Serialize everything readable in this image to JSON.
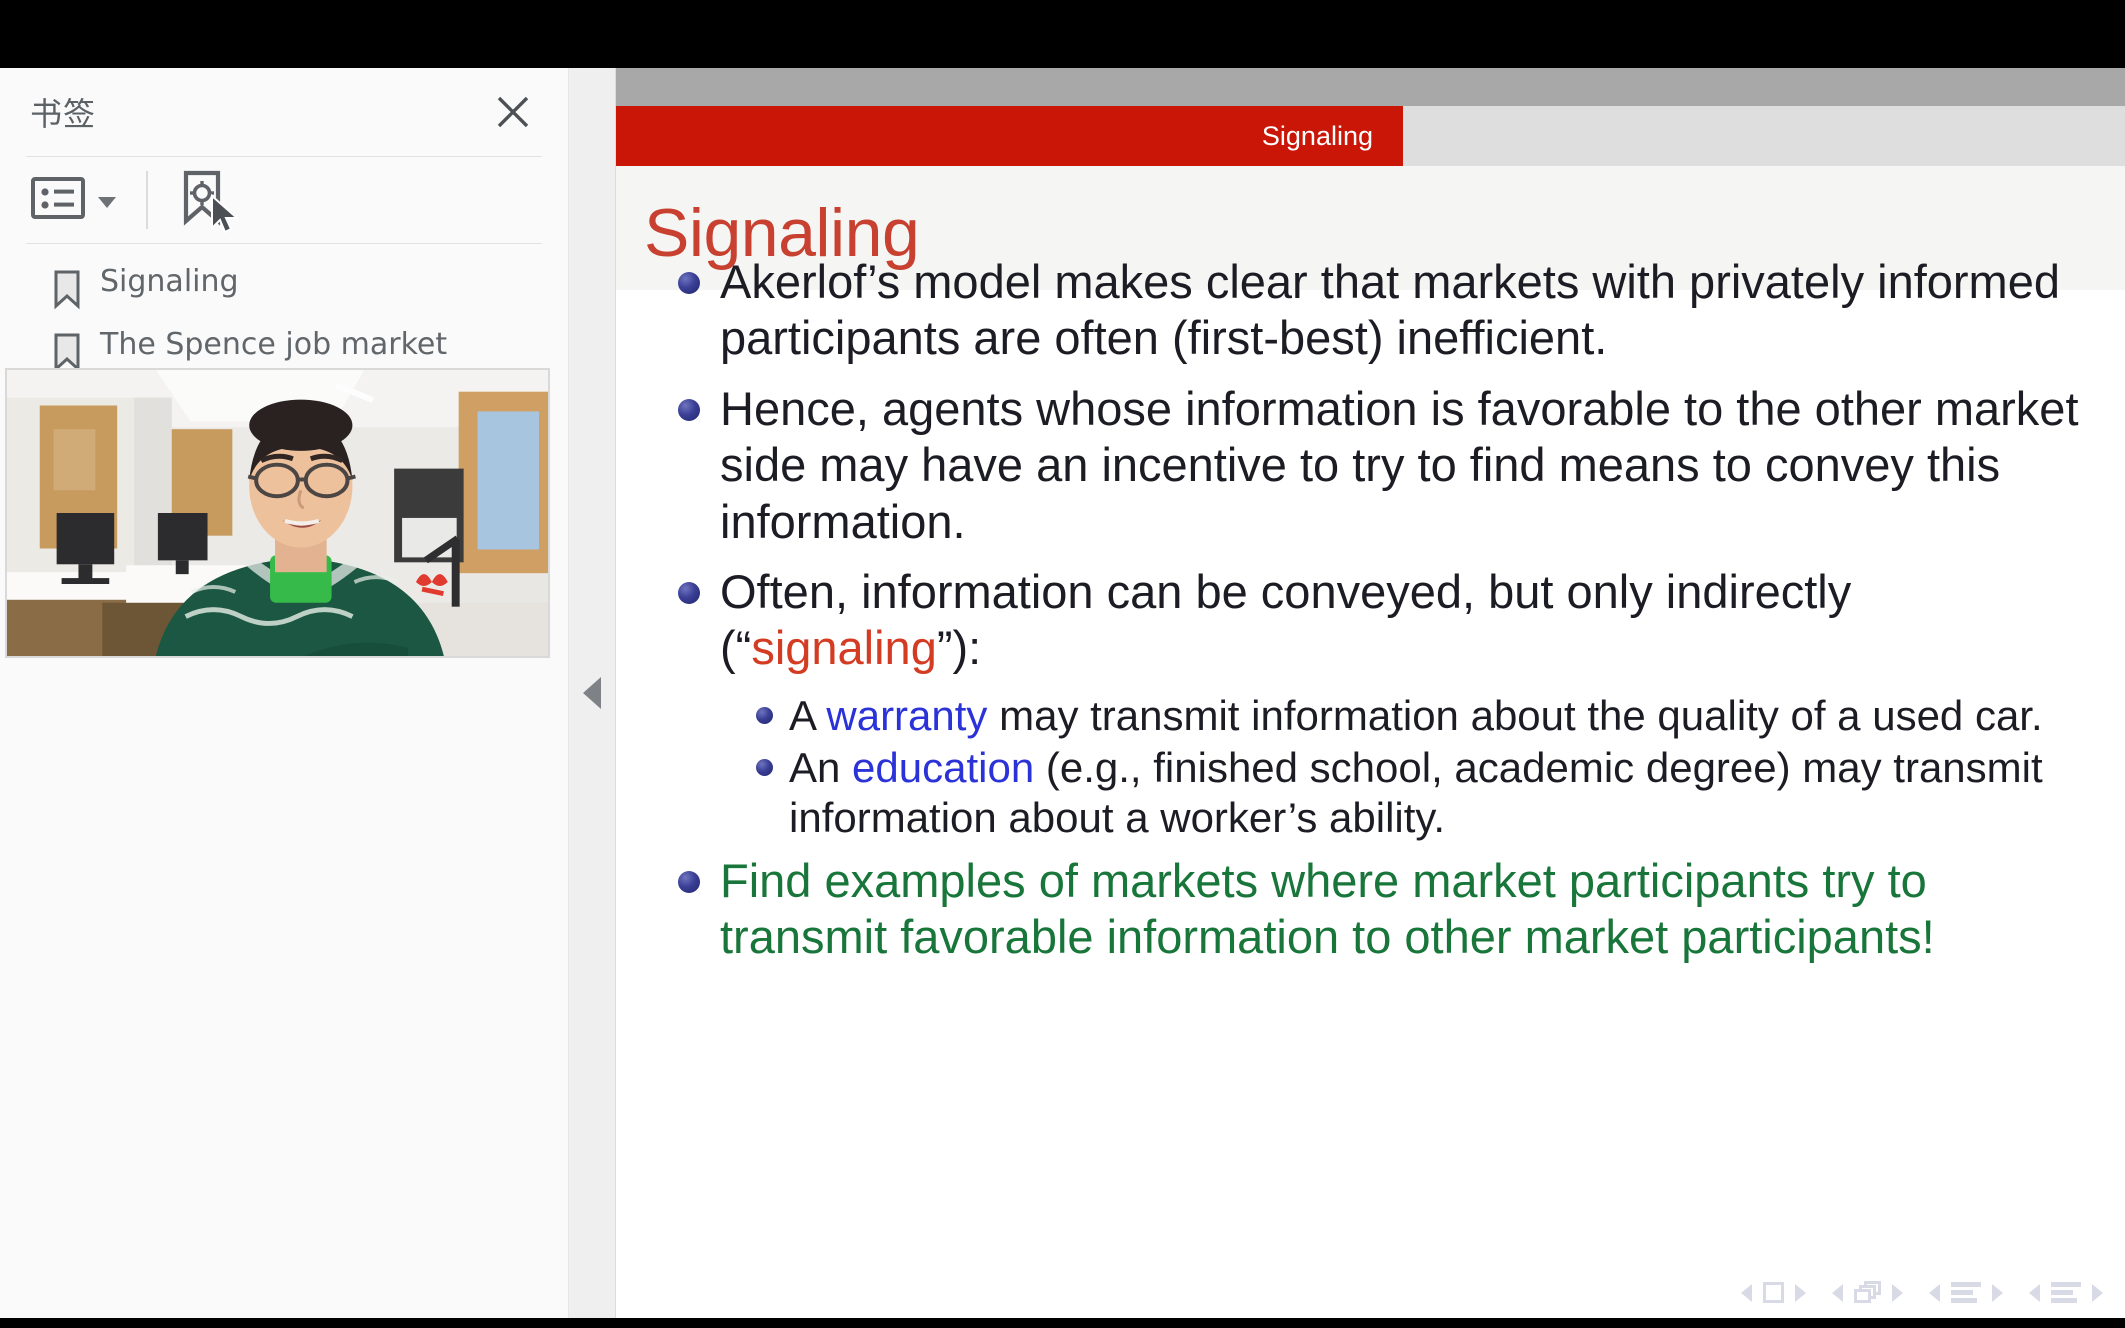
{
  "sidebar": {
    "title": "书签",
    "close_icon": "close-icon",
    "toolbar": {
      "list_options_icon": "list-options-icon",
      "dropdown_caret_icon": "chevron-down-icon",
      "add_bookmark_icon": "add-bookmark-icon",
      "cursor_icon": "cursor-arrow-icon"
    },
    "bookmarks": [
      {
        "label": "Signaling",
        "icon": "bookmark-icon"
      },
      {
        "label": "The Spence job market model",
        "icon": "bookmark-icon"
      }
    ],
    "webcam": {
      "alt": "webcam-video-of-presenter"
    }
  },
  "splitter": {
    "collapse_icon": "collapse-sidebar-triangle-icon"
  },
  "slide": {
    "header_label": "Signaling",
    "title": "Signaling",
    "colors": {
      "header_red": "#ca1607",
      "title_red": "#c8402f",
      "bullet_blue": "#2b33d8",
      "accent_green": "#19763a",
      "bullet_ball": "#3a3f96"
    },
    "bullets": [
      {
        "id": "bullet-akerlof",
        "lines": [
          "Akerlof’s model makes clear that markets with privately informed",
          "participants are often (first-best) inefficient."
        ]
      },
      {
        "id": "bullet-hence",
        "lines": [
          "Hence, agents whose information is favorable to the other market",
          "side may have an incentive to try to find means to convey this",
          "information."
        ]
      },
      {
        "id": "bullet-often",
        "line1": "Often, information can be conveyed, but only indirectly",
        "line2_pre": "(“",
        "line2_highlight": "signaling",
        "line2_post": "”):"
      }
    ],
    "sub_bullets": [
      {
        "id": "sub-bullet-warranty",
        "pre": "A ",
        "highlight": "warranty",
        "post": " may transmit information about the quality of a used car.",
        "line2": ""
      },
      {
        "id": "sub-bullet-education",
        "pre": "An ",
        "highlight": "education",
        "post": " (e.g., finished school, academic degree) may transmit",
        "line2": "information about a worker’s ability."
      }
    ],
    "closing_bullet": {
      "id": "bullet-find-examples",
      "lines": [
        "Find examples of markets where market participants try to",
        "transmit favorable information to other market participants!"
      ]
    },
    "nav_symbols": [
      {
        "name": "nav-slide",
        "icon": "square-icon"
      },
      {
        "name": "nav-frame",
        "icon": "stacked-frames-icon"
      },
      {
        "name": "nav-subsection",
        "icon": "lines-icon"
      },
      {
        "name": "nav-section",
        "icon": "lines-icon"
      }
    ]
  }
}
